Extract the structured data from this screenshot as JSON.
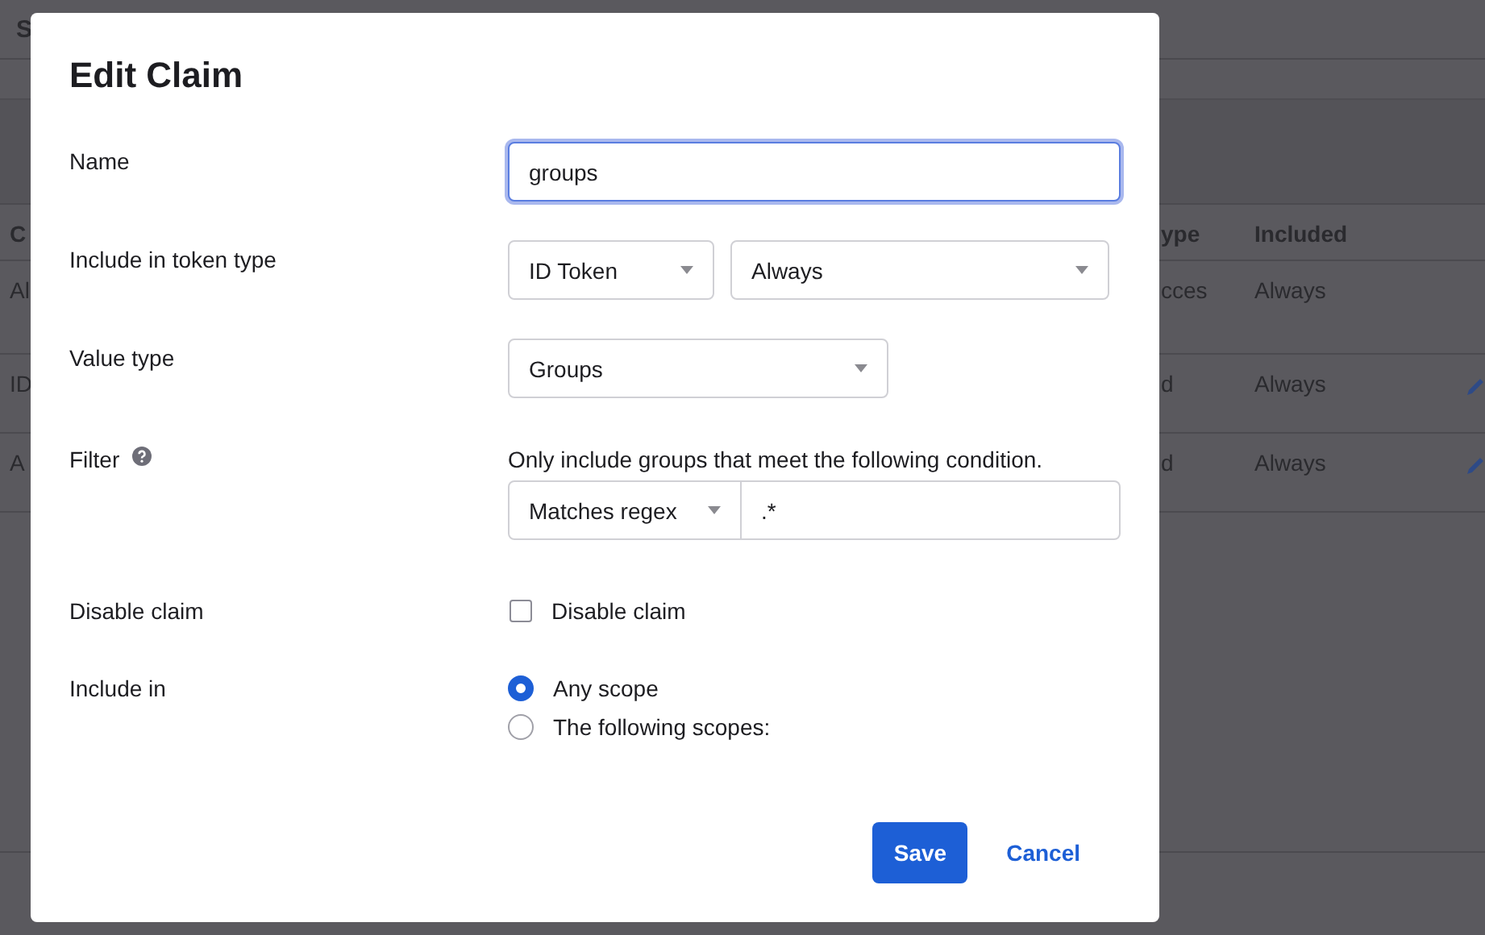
{
  "background": {
    "top_bar_text": "S",
    "table": {
      "columns": [
        "C",
        "ype",
        "Included"
      ],
      "rows": [
        {
          "cells": [
            "Al",
            "cces",
            "Always"
          ],
          "editable": false
        },
        {
          "cells": [
            "ID",
            "d",
            "Always"
          ],
          "editable": true
        },
        {
          "cells": [
            "A",
            "d",
            "Always"
          ],
          "editable": true
        }
      ]
    }
  },
  "dialog": {
    "title": "Edit Claim",
    "fields": [
      {
        "kind": "text",
        "label": "Name",
        "value": "groups",
        "focused": true
      },
      {
        "kind": "selects",
        "label": "Include in token type",
        "selects": [
          {
            "value": "ID Token"
          },
          {
            "value": "Always"
          }
        ]
      },
      {
        "kind": "selects",
        "label": "Value type",
        "selects": [
          {
            "value": "Groups"
          }
        ]
      },
      {
        "kind": "filter",
        "label": "Filter",
        "help": true,
        "description": "Only include groups that meet the following condition.",
        "operator": "Matches regex",
        "value": ".*"
      },
      {
        "kind": "checkbox",
        "label": "Disable claim",
        "option": "Disable claim",
        "checked": false
      },
      {
        "kind": "radio",
        "label": "Include in",
        "options": [
          {
            "label": "Any scope",
            "selected": true
          },
          {
            "label": "The following scopes:",
            "selected": false
          }
        ]
      }
    ],
    "buttons": [
      {
        "label": "Save",
        "kind": "primary"
      },
      {
        "label": "Cancel",
        "kind": "link"
      }
    ]
  }
}
